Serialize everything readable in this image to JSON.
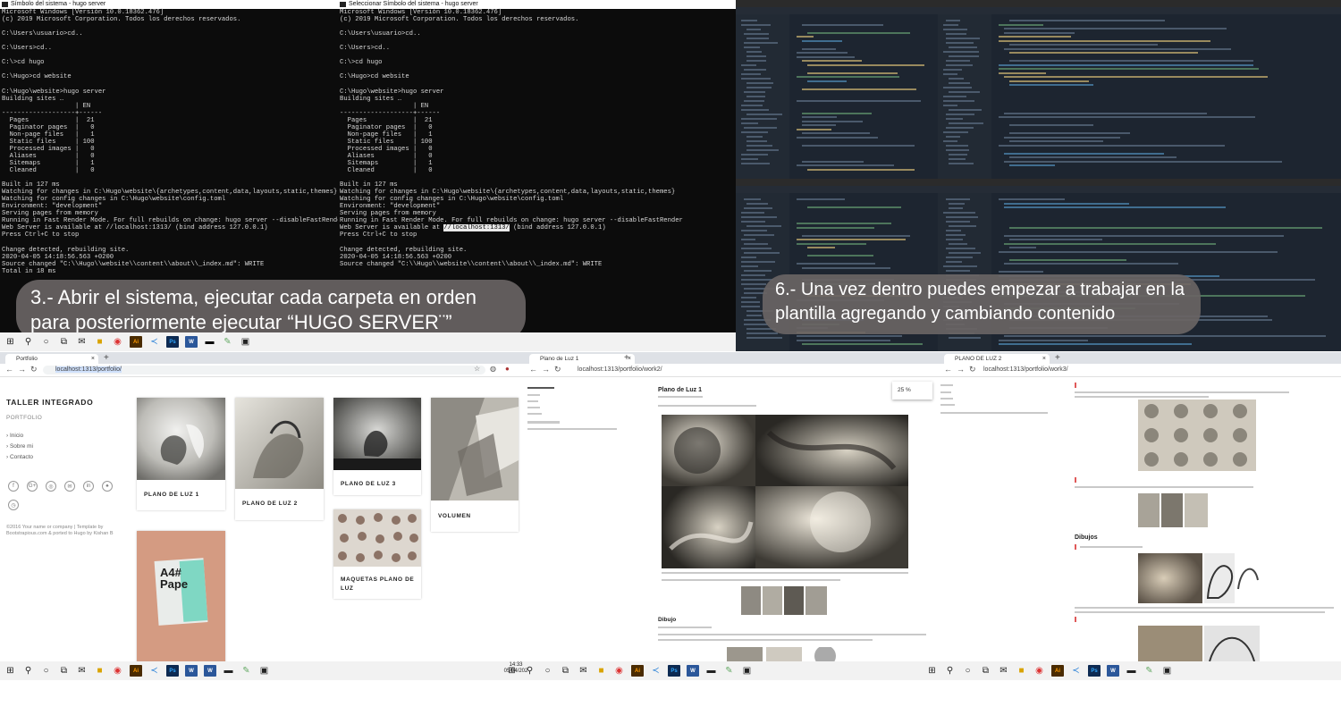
{
  "console1": {
    "title": "Símbolo del sistema - hugo  server",
    "lines": [
      "Microsoft Windows [Versión 10.0.18362.476]",
      "(c) 2019 Microsoft Corporation. Todos los derechos reservados.",
      "",
      "C:\\Users\\usuario>cd..",
      "",
      "C:\\Users>cd..",
      "",
      "C:\\>cd hugo",
      "",
      "C:\\Hugo>cd website",
      "",
      "C:\\Hugo\\website>hugo server",
      "Building sites …",
      "                   | EN",
      "-------------------+------",
      "  Pages            |  21",
      "  Paginator pages  |   0",
      "  Non-page files   |   1",
      "  Static files     | 100",
      "  Processed images |   0",
      "  Aliases          |   0",
      "  Sitemaps         |   1",
      "  Cleaned          |   0",
      "",
      "Built in 127 ms",
      "Watching for changes in C:\\Hugo\\website\\{archetypes,content,data,layouts,static,themes}",
      "Watching for config changes in C:\\Hugo\\website\\config.toml",
      "Environment: \"development\"",
      "Serving pages from memory",
      "Running in Fast Render Mode. For full rebuilds on change: hugo server --disableFastRender",
      "Web Server is available at //localhost:1313/ (bind address 127.0.0.1)",
      "Press Ctrl+C to stop",
      "",
      "Change detected, rebuilding site.",
      "2020-04-05 14:18:56.563 +0200",
      "Source changed \"C:\\\\Hugo\\\\website\\\\content\\\\about\\\\_index.md\": WRITE",
      "Total in 18 ms"
    ]
  },
  "console2": {
    "title": "Seleccionar Símbolo del sistema - hugo  server",
    "lines_before": [
      "Microsoft Windows [Versión 10.0.18362.476]",
      "(c) 2019 Microsoft Corporation. Todos los derechos reservados.",
      "",
      "C:\\Users\\usuario>cd..",
      "",
      "C:\\Users>cd..",
      "",
      "C:\\>cd hugo",
      "",
      "C:\\Hugo>cd website",
      "",
      "C:\\Hugo\\website>hugo server",
      "Building sites …",
      "                   | EN",
      "-------------------+------",
      "  Pages            |  21",
      "  Paginator pages  |   0",
      "  Non-page files   |   1",
      "  Static files     | 100",
      "  Processed images |   0",
      "  Aliases          |   0",
      "  Sitemaps         |   1",
      "  Cleaned          |   0",
      "",
      "Built in 127 ms",
      "Watching for changes in C:\\Hugo\\website\\{archetypes,content,data,layouts,static,themes}",
      "Watching for config changes in C:\\Hugo\\website\\config.toml",
      "Environment: \"development\"",
      "Serving pages from memory",
      "Running in Fast Render Mode. For full rebuilds on change: hugo server --disableFastRender"
    ],
    "server_prefix": "Web Server is available at ",
    "server_url": "//localhost:1313/",
    "server_suffix": " (bind address 127.0.0.1)",
    "lines_after": [
      "Press Ctrl+C to stop",
      "",
      "Change detected, rebuilding site.",
      "2020-04-05 14:18:56.563 +0200",
      "Source changed \"C:\\\\Hugo\\\\website\\\\content\\\\about\\\\_index.md\": WRITE"
    ]
  },
  "captions": {
    "step3": "3.- Abrir el sistema, ejecutar cada carpeta en orden para posteriormente ejecutar “HUGO SERVER¨”",
    "step6": "6.- Una vez dentro puedes empezar a trabajar en la plantilla agregando y cambiando contenido"
  },
  "browser1": {
    "tab_title": "Portfolio",
    "url": "localhost:1313/portfolio/",
    "site_title": "TALLER INTEGRADO",
    "site_subtitle": "PORTFOLIO",
    "nav": [
      "› Inicio",
      "› Sobre mi",
      "› Contacto"
    ],
    "social": [
      "f",
      "G+",
      "◎",
      "✉",
      "in",
      "♠",
      "◷"
    ],
    "footer": "©2016 Your name or company | Template by Bootstrapious.com & ported to Hugo by Kishan B",
    "cards": [
      "PLANO DE LUZ 1",
      "PLANO DE LUZ 2",
      "PLANO DE LUZ 3",
      "VOLUMEN",
      "MAQUETAS PLANO DE LUZ"
    ],
    "poster_text": "A4# Pape"
  },
  "browser2": {
    "tab_title": "Plano de Luz 1",
    "url": "localhost:1313/portfolio/work2/",
    "heading": "Plano de Luz 1",
    "zoom": "25 %",
    "section": "Dibujo"
  },
  "browser3": {
    "tab_title": "PLANO DE LUZ 2",
    "url": "localhost:1313/portfolio/work3/",
    "section": "Dibujos"
  },
  "clock": {
    "time": "14:33",
    "date": "05/04/202"
  },
  "colors": {
    "console_bg": "#0c0c0c",
    "caption_bg": "#6a6464",
    "editor_bg": "#1d2530",
    "taskbar_bg": "#f2f2f2"
  }
}
